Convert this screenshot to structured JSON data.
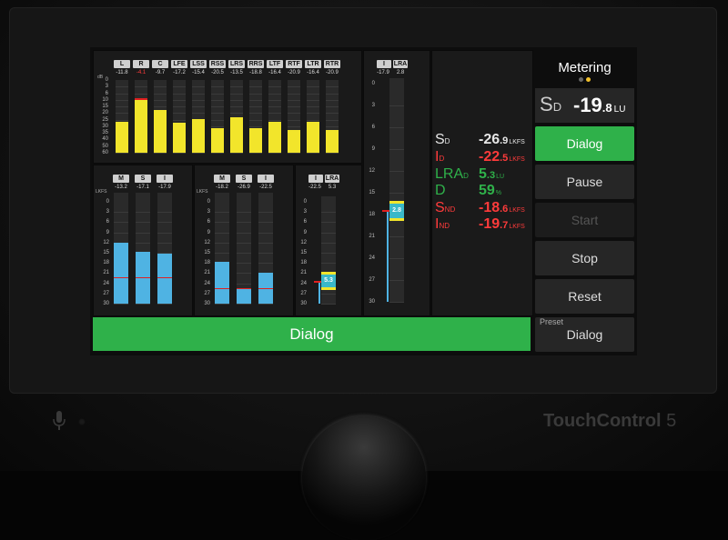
{
  "device": {
    "brand": "TouchControl",
    "model_number": "5"
  },
  "header": {
    "title": "Metering"
  },
  "loudness_readout": {
    "label": "S",
    "sublabel": "D",
    "value_int": "-19",
    "value_dec": ".8",
    "unit": "LU"
  },
  "top_meter": {
    "unit_label": "dB",
    "scale": [
      "0",
      "3",
      "6",
      "10",
      "15",
      "20",
      "25",
      "30",
      "35",
      "40",
      "50",
      "60"
    ],
    "channels": [
      {
        "name": "L",
        "peak": "-11.8",
        "level": 0.42
      },
      {
        "name": "R",
        "peak": "-4.1",
        "level": 0.72,
        "over": true
      },
      {
        "name": "C",
        "peak": "-9.7",
        "level": 0.59
      },
      {
        "name": "LFE",
        "peak": "-17.2",
        "level": 0.41
      },
      {
        "name": "LSS",
        "peak": "-15.4",
        "level": 0.46
      },
      {
        "name": "RSS",
        "peak": "-20.5",
        "level": 0.34
      },
      {
        "name": "LRS",
        "peak": "-13.5",
        "level": 0.49
      },
      {
        "name": "RRS",
        "peak": "-18.8",
        "level": 0.34
      },
      {
        "name": "LTF",
        "peak": "-16.4",
        "level": 0.42
      },
      {
        "name": "RTF",
        "peak": "-20.9",
        "level": 0.31
      },
      {
        "name": "LTR",
        "peak": "-16.4",
        "level": 0.42
      },
      {
        "name": "RTR",
        "peak": "-20.9",
        "level": 0.31
      }
    ]
  },
  "loudness_group_1": {
    "unit_label": "LKFS",
    "scale": [
      "0",
      "3",
      "6",
      "9",
      "12",
      "15",
      "18",
      "21",
      "24",
      "27",
      "30"
    ],
    "meters": [
      {
        "name": "M",
        "value": "-13.2",
        "level": 0.55
      },
      {
        "name": "S",
        "value": "-17.1",
        "level": 0.47
      },
      {
        "name": "I",
        "value": "-17.9",
        "level": 0.45
      }
    ],
    "target_level": 0.23
  },
  "loudness_group_2": {
    "unit_label": "LKFS",
    "scale": [
      "0",
      "3",
      "6",
      "9",
      "12",
      "15",
      "18",
      "21",
      "24",
      "27",
      "30"
    ],
    "meters": [
      {
        "name": "M",
        "value": "-18.2",
        "level": 0.38
      },
      {
        "name": "S",
        "value": "-26.9",
        "level": 0.13
      },
      {
        "name": "I",
        "value": "-22.5",
        "level": 0.28
      }
    ],
    "target_level": 0.13
  },
  "lra_small": {
    "labels": [
      "I",
      "LRA"
    ],
    "values": [
      "-22.5",
      "5.3"
    ],
    "scale": [
      "0",
      "3",
      "6",
      "9",
      "12",
      "15",
      "18",
      "21",
      "24",
      "27",
      "30"
    ],
    "range_value": "5.3"
  },
  "lra_large": {
    "labels": [
      "I",
      "LRA"
    ],
    "values": [
      "-17.9",
      "2.8"
    ],
    "scale": [
      "0",
      "3",
      "6",
      "9",
      "12",
      "15",
      "18",
      "21",
      "24",
      "27",
      "30"
    ],
    "range_value": "2.8"
  },
  "stats": [
    {
      "label": "S",
      "sub": "D",
      "value_int": "-26",
      "value_dec": ".9",
      "unit": "LKFS",
      "color": "#e6e6e6"
    },
    {
      "label": "I",
      "sub": "D",
      "value_int": "-22",
      "value_dec": ".5",
      "unit": "LKFS",
      "color": "#ff3b3b"
    },
    {
      "label": "LRA",
      "sub": "D",
      "value_int": "5",
      "value_dec": ".3",
      "unit": "LU",
      "color": "#2fb14a"
    },
    {
      "label": "D",
      "sub": "",
      "value_int": "59",
      "value_dec": "",
      "unit": "%",
      "color": "#2fb14a"
    },
    {
      "label": "S",
      "sub": "ND",
      "value_int": "-18",
      "value_dec": ".6",
      "unit": "LKFS",
      "color": "#ff3b3b"
    },
    {
      "label": "I",
      "sub": "ND",
      "value_int": "-19",
      "value_dec": ".7",
      "unit": "LKFS",
      "color": "#ff3b3b"
    }
  ],
  "buttons": {
    "dialog": "Dialog",
    "pause": "Pause",
    "start": "Start",
    "stop": "Stop",
    "reset": "Reset",
    "preset_label": "Preset",
    "preset_value": "Dialog"
  },
  "bottom_bar": {
    "label": "Dialog"
  },
  "colors": {
    "green": "#2fb14a",
    "yellow": "#f2e52b",
    "blue": "#4fb3e3",
    "red": "#ff3b3b"
  }
}
